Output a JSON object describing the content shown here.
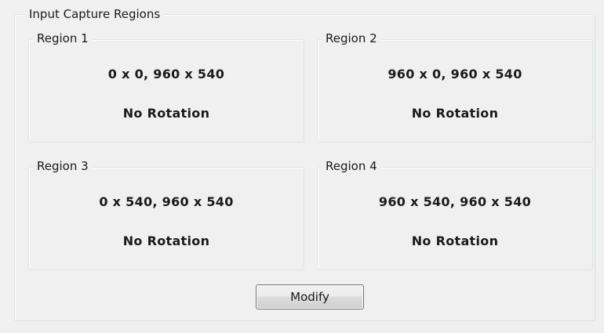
{
  "group": {
    "title": "Input Capture Regions"
  },
  "regions": [
    {
      "label": "Region 1",
      "coords": "0 x 0, 960 x 540",
      "rotation": "No Rotation"
    },
    {
      "label": "Region 2",
      "coords": "960 x 0, 960 x 540",
      "rotation": "No Rotation"
    },
    {
      "label": "Region 3",
      "coords": "0 x 540, 960 x 540",
      "rotation": "No Rotation"
    },
    {
      "label": "Region 4",
      "coords": "960 x 540, 960 x 540",
      "rotation": "No Rotation"
    }
  ],
  "actions": {
    "modify_label": "Modify"
  }
}
